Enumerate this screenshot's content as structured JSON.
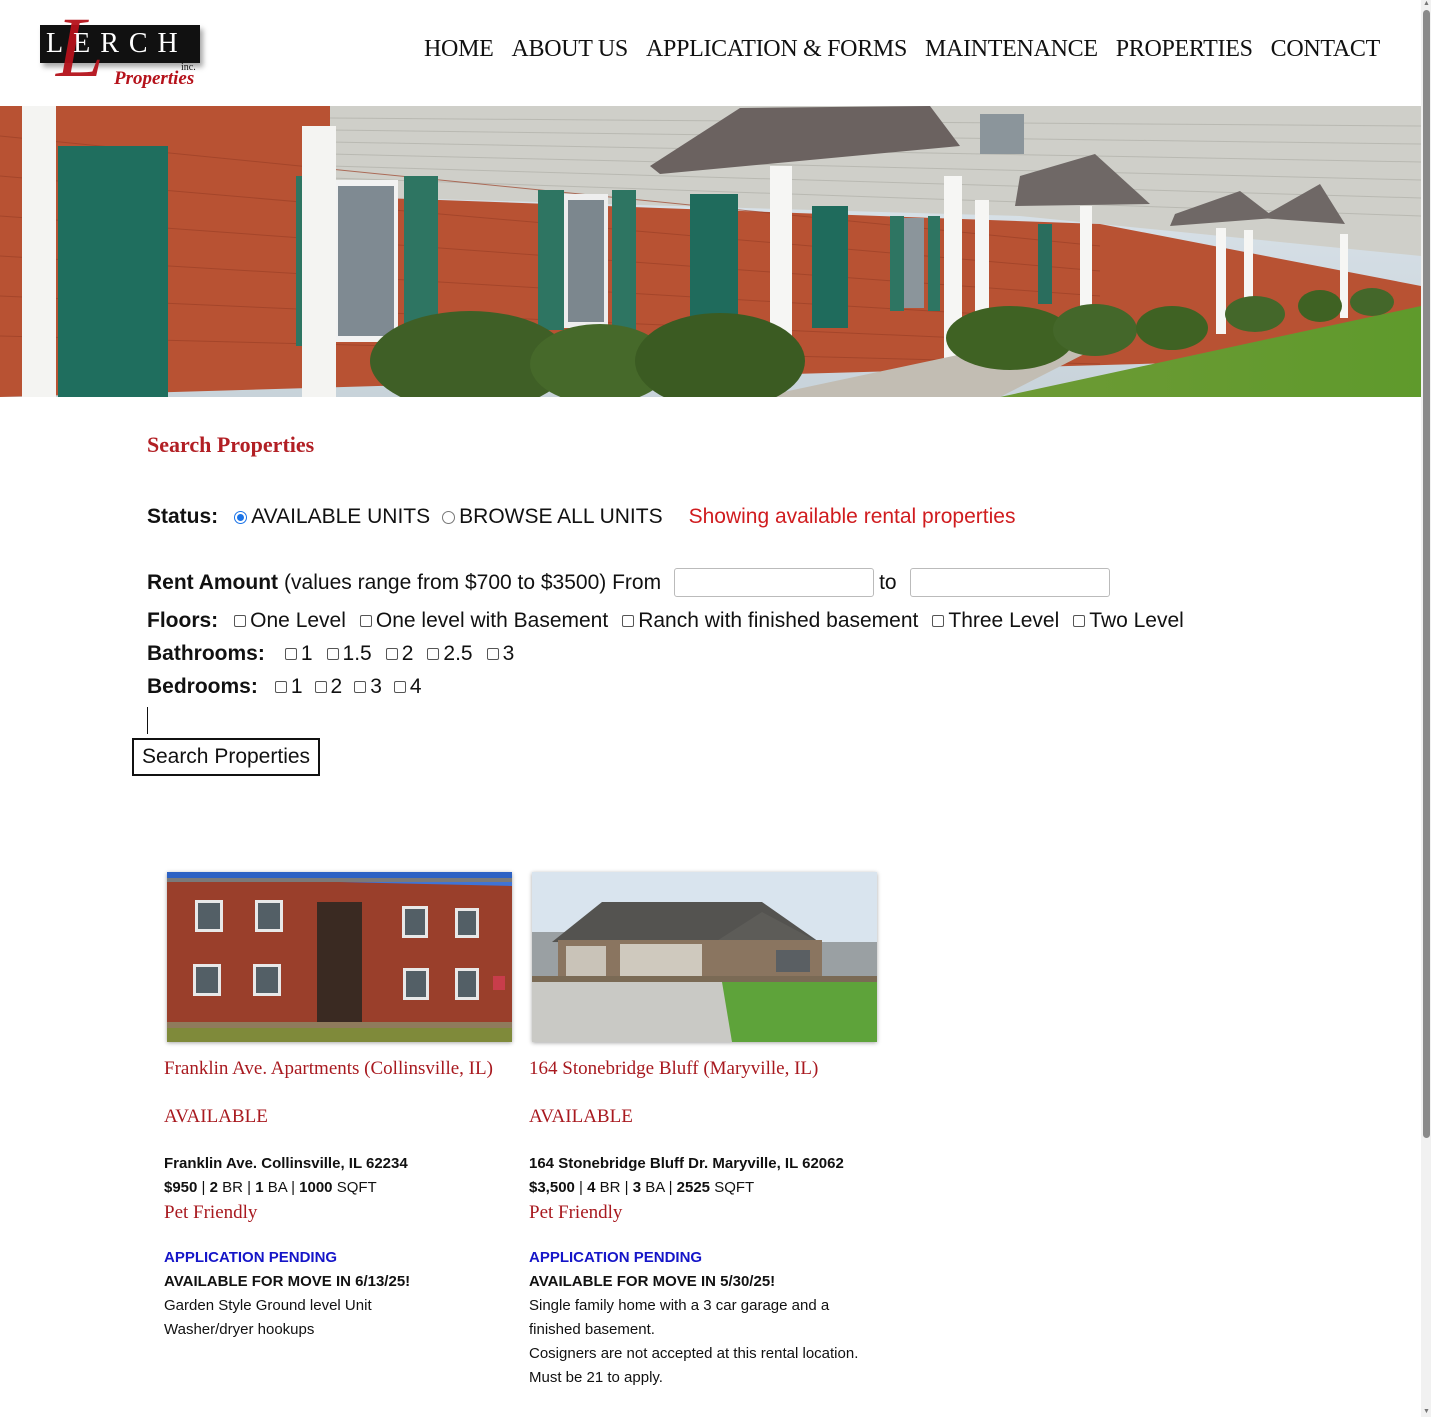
{
  "brand": {
    "logo_word": "LERCH",
    "logo_initial": "L",
    "logo_inc": "inc.",
    "logo_sub": "Properties"
  },
  "nav": [
    "HOME",
    "ABOUT US",
    "APPLICATION & FORMS",
    "MAINTENANCE",
    "PROPERTIES",
    "CONTACT"
  ],
  "search": {
    "title": "Search Properties",
    "status_label": "Status:",
    "status_options": [
      "AVAILABLE UNITS",
      "BROWSE ALL UNITS"
    ],
    "status_selected": "AVAILABLE UNITS",
    "status_message": "Showing available rental properties",
    "rent_label": "Rent Amount",
    "rent_hint": "(values range from $700 to $3500) From",
    "rent_to": "to",
    "rent_from_value": "",
    "rent_to_value": "",
    "floors_label": "Floors:",
    "floors_options": [
      "One Level",
      "One level with Basement",
      "Ranch with finished basement",
      "Three Level",
      "Two Level"
    ],
    "bathrooms_label": "Bathrooms:",
    "bathrooms_options": [
      "1",
      "1.5",
      "2",
      "2.5",
      "3"
    ],
    "bedrooms_label": "Bedrooms:",
    "bedrooms_options": [
      "1",
      "2",
      "3",
      "4"
    ],
    "button_label": "Search Properties"
  },
  "listings": [
    {
      "title": "Franklin Ave. Apartments (Collinsville, IL)",
      "status": "AVAILABLE",
      "address": "Franklin Ave. Collinsville, IL 62234",
      "price": "$950",
      "br": "2",
      "ba": "1",
      "sqft": "1000",
      "pet": "Pet Friendly",
      "pending": "APPLICATION PENDING",
      "move_in": "AVAILABLE FOR MOVE IN 6/13/25!",
      "notes": [
        "Garden Style Ground level Unit",
        "Washer/dryer hookups"
      ]
    },
    {
      "title": "164 Stonebridge Bluff (Maryville, IL)",
      "status": "AVAILABLE",
      "address": "164 Stonebridge Bluff Dr. Maryville, IL 62062",
      "price": "$3,500",
      "br": "4",
      "ba": "3",
      "sqft": "2525",
      "pet": "Pet Friendly",
      "pending": "APPLICATION PENDING",
      "move_in": "AVAILABLE FOR MOVE IN 5/30/25!",
      "notes": [
        "Single family home with a 3 car garage and a",
        "finished basement.",
        "Cosigners are not accepted at this rental location.",
        "Must be 21 to apply."
      ]
    }
  ],
  "units": {
    "br": "BR",
    "ba": "BA",
    "sqft": "SQFT"
  },
  "colors": {
    "accent": "#b21f24",
    "message": "#d01c1f",
    "pending": "#1515c8"
  }
}
